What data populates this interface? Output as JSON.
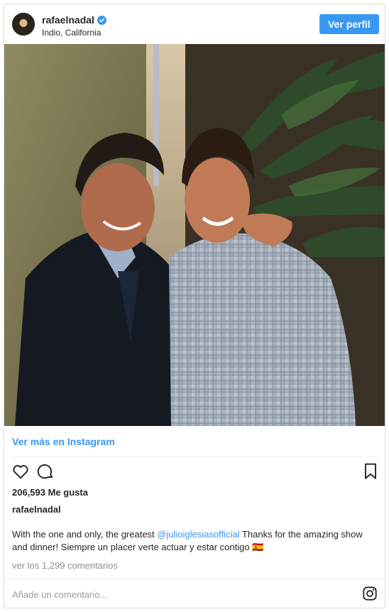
{
  "header": {
    "username": "rafaelnadal",
    "location": "Indio, California",
    "profile_button": "Ver perfil",
    "verified_icon": "verified-badge-icon"
  },
  "post": {
    "view_more_link": "Ver más en Instagram",
    "likes": "206,593 Me gusta",
    "caption_username": "rafaelnadal",
    "caption_before_mention": "With the one and only, the greatest ",
    "caption_mention": "@julioiglesiasofficial",
    "caption_after_mention": " Thanks for the amazing show and dinner! Siempre un placer verte actuar y estar contigo 🇪🇸",
    "comments_link": "ver los 1,299 comentarios",
    "comment_placeholder": "Añade un comentario..."
  },
  "icons": [
    "heart-icon",
    "comment-icon",
    "bookmark-icon",
    "instagram-logo-icon"
  ],
  "colors": {
    "accent": "#3897f0",
    "text": "#262626",
    "muted": "#8e8e8e",
    "border": "#dbdbdb"
  }
}
